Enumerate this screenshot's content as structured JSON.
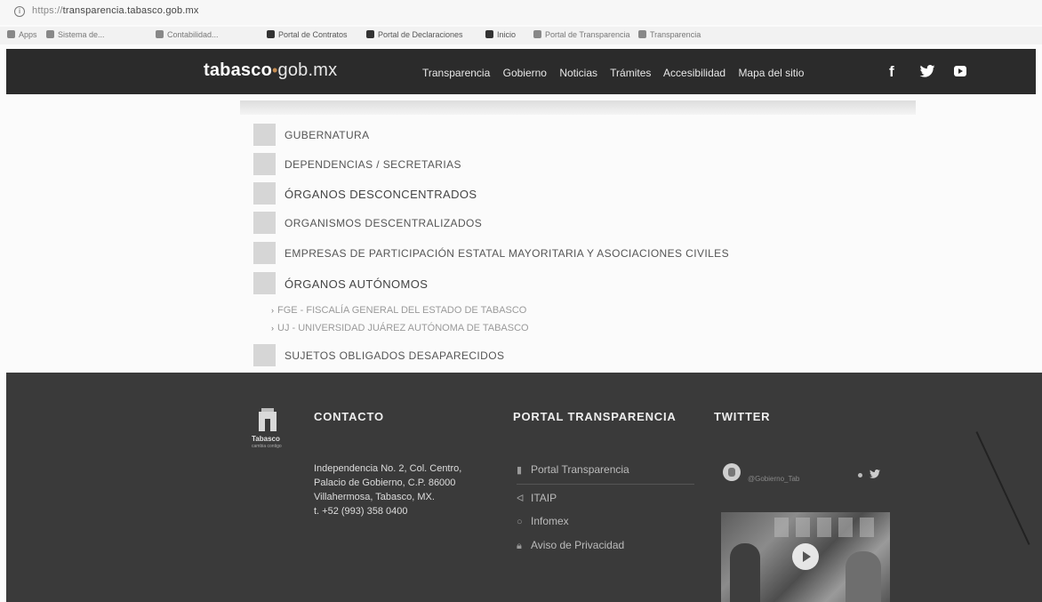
{
  "browser": {
    "url_prefix": "https://",
    "url_host": "transparencia.tabasco.gob.mx",
    "bookmarks": [
      "Apps",
      "Sistema de...",
      "Contabilidad...",
      "Portal de Contratos",
      "Portal de Declaraciones",
      "Inicio",
      "Portal de Transparencia",
      "Transparencia"
    ]
  },
  "header": {
    "logo_bold": "tabasco",
    "logo_dot": "•",
    "logo_rest": "gob.mx",
    "nav": [
      "Transparencia",
      "Gobierno",
      "Noticias",
      "Trámites",
      "Accesibilidad",
      "Mapa del sitio"
    ],
    "social_facebook": "f"
  },
  "categories": [
    "GUBERNATURA",
    "DEPENDENCIAS / SECRETARIAS",
    "ÓRGANOS DESCONCENTRADOS",
    "ORGANISMOS DESCENTRALIZADOS",
    "EMPRESAS DE PARTICIPACIÓN ESTATAL MAYORITARIA Y ASOCIACIONES CIVILES",
    "ÓRGANOS AUTÓNOMOS"
  ],
  "autonomos_items": [
    "FGE - FISCALÍA GENERAL DEL ESTADO DE TABASCO",
    "UJ - UNIVERSIDAD JUÁREZ AUTÓNOMA DE TABASCO"
  ],
  "extra_category": "SUJETOS OBLIGADOS DESAPARECIDOS",
  "footer": {
    "logo_name": "Tabasco",
    "logo_sub": "cambia contigo",
    "contact_title": "CONTACTO",
    "contact_lines": [
      "Independencia No. 2, Col. Centro,",
      "Palacio de Gobierno, C.P. 86000",
      "Villahermosa, Tabasco, MX.",
      "t. +52 (993) 358 0400"
    ],
    "portal_title": "PORTAL TRANSPARENCIA",
    "portal_links": [
      "Portal Transparencia",
      "ITAIP",
      "Infomex",
      "Aviso de Privacidad"
    ],
    "twitter_title": "TWITTER",
    "twitter_handle": "@Gobierno_Tab"
  },
  "colors": {
    "header_bg": "#2b2b2b",
    "footer_bg": "#3a3a3a",
    "logo_dot": "#c78d52"
  }
}
